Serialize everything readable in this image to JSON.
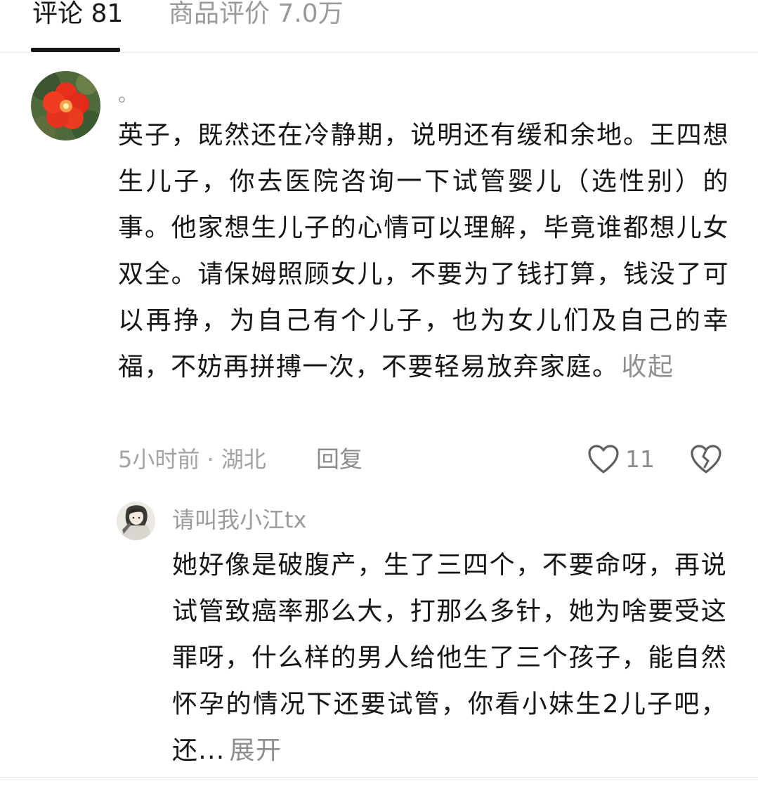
{
  "tabs": {
    "comments_label": "评论 81",
    "reviews_label": "商品评价 7.0万"
  },
  "comment": {
    "username": "。",
    "text": "英子，既然还在冷静期，说明还有缓和余地。王四想生儿子，你去医院咨询一下试管婴儿（选性别）的事。他家想生儿子的心情可以理解，毕竟谁都想儿女双全。请保姆照顾女儿，不要为了钱打算，钱没了可以再挣，为自己有个儿子，也为女儿们及自己的幸福，不妨再拼搏一次，不要轻易放弃家庭。",
    "collapse_label": "收起",
    "time": "5小时前",
    "separator": "·",
    "location": "湖北",
    "reply_label": "回复",
    "like_count": "11",
    "avatar_icon": "red-flower-avatar",
    "like_icon": "heart-outline-icon",
    "dislike_icon": "broken-heart-icon"
  },
  "reply": {
    "username": "请叫我小江tx",
    "text": "她好像是破腹产，生了三四个，不要命呀，再说试管致癌率那么大，打那么多针，她为啥要受这罪呀，什么样的男人给他生了三个孩子，能自然怀孕的情况下还要试管，你看小妹生2儿子吧，还...",
    "expand_label": "展开",
    "avatar_icon": "anime-character-avatar"
  },
  "colors": {
    "text_primary": "#161616",
    "text_secondary": "#9b9b9b",
    "divider": "#ececec"
  }
}
